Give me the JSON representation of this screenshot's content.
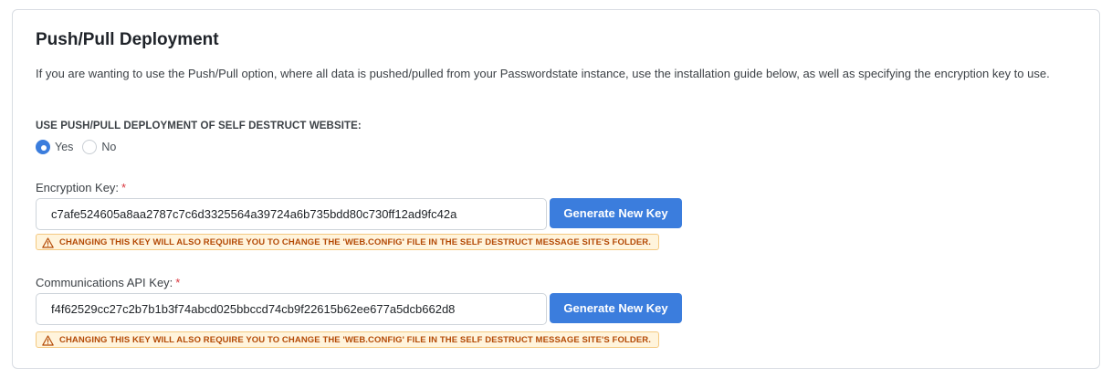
{
  "section": {
    "title": "Push/Pull Deployment",
    "description": "If you are wanting to use the Push/Pull option, where all data is pushed/pulled from your Passwordstate instance, use the installation guide below, as well as specifying the encryption key to use."
  },
  "deployment_option": {
    "label": "USE PUSH/PULL DEPLOYMENT OF SELF DESTRUCT WEBSITE:",
    "options": [
      "Yes",
      "No"
    ],
    "selected": "Yes"
  },
  "encryption_key": {
    "label": "Encryption Key:",
    "required_marker": "*",
    "value": "c7afe524605a8aa2787c7c6d3325564a39724a6b735bdd80c730ff12ad9fc42a",
    "button_label": "Generate New Key",
    "warning": "CHANGING THIS KEY WILL ALSO REQUIRE YOU TO CHANGE THE 'WEB.CONFIG' FILE IN THE SELF DESTRUCT MESSAGE SITE'S FOLDER."
  },
  "api_key": {
    "label": "Communications API Key:",
    "required_marker": "*",
    "value": "f4f62529cc27c2b7b1b3f74abcd025bbccd74cb9f22615b62ee677a5dcb662d8",
    "button_label": "Generate New Key",
    "warning": "CHANGING THIS KEY WILL ALSO REQUIRE YOU TO CHANGE THE 'WEB.CONFIG' FILE IN THE SELF DESTRUCT MESSAGE SITE'S FOLDER."
  },
  "colors": {
    "primary": "#3b7ddd",
    "required": "#d9363e",
    "warning_bg": "#fff4dc",
    "warning_text": "#b44a06"
  },
  "icons": {
    "warning": "warning-triangle-icon"
  }
}
